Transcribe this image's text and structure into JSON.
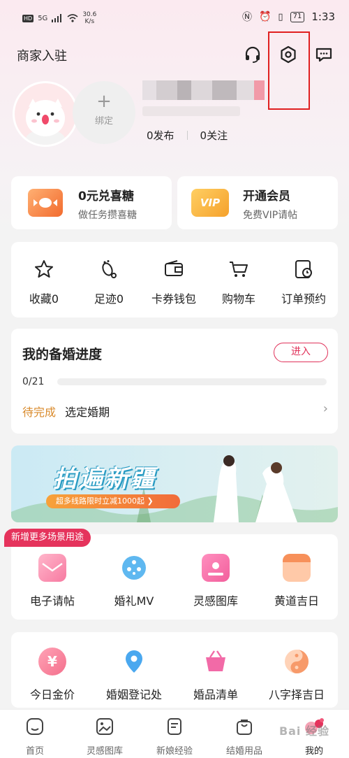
{
  "status_bar": {
    "hd": "HD",
    "signal": "5G",
    "speed": "30.6",
    "speed_unit": "K/s",
    "battery": "71",
    "time": "1:33"
  },
  "header": {
    "merchant_label": "商家入驻",
    "icons": [
      "headset-icon",
      "settings-icon",
      "message-icon"
    ]
  },
  "profile": {
    "bind_plus": "+",
    "bind_label": "绑定",
    "posts": "0发布",
    "follows": "0关注"
  },
  "promos": [
    {
      "title": "0元兑喜糖",
      "subtitle": "做任务攒喜糖",
      "icon": "candy-icon"
    },
    {
      "title": "开通会员",
      "subtitle": "免费VIP请帖",
      "icon": "vip-icon",
      "badge": "VIP"
    }
  ],
  "quick_actions": [
    {
      "label": "收藏0",
      "icon": "star-icon"
    },
    {
      "label": "足迹0",
      "icon": "footprint-icon"
    },
    {
      "label": "卡券钱包",
      "icon": "wallet-icon"
    },
    {
      "label": "购物车",
      "icon": "cart-icon"
    },
    {
      "label": "订单预约",
      "icon": "order-clock-icon"
    }
  ],
  "progress": {
    "title": "我的备婚进度",
    "enter": "进入",
    "count": "0/21",
    "ratio": 0,
    "todo_tag": "待完成",
    "todo_text": "选定婚期",
    "chevron": "›"
  },
  "banner": {
    "title": "拍遍新疆",
    "pill": "超多线路限时立减1000起 ❯"
  },
  "new_tag": "新增更多场景用途",
  "tools_row1": [
    {
      "label": "电子请帖",
      "icon": "invitation-icon",
      "color": "#f77aa1"
    },
    {
      "label": "婚礼MV",
      "icon": "film-reel-icon",
      "color": "#5fb8f0"
    },
    {
      "label": "灵感图库",
      "icon": "gallery-icon",
      "color": "#f25f9c"
    },
    {
      "label": "黄道吉日",
      "icon": "calendar-icon",
      "color": "#f7905a"
    }
  ],
  "tools_row2": [
    {
      "label": "今日金价",
      "icon": "gold-price-icon",
      "color": "#f46f8c"
    },
    {
      "label": "婚姻登记处",
      "icon": "location-pin-icon",
      "color": "#4aa8ef"
    },
    {
      "label": "婚品清单",
      "icon": "basket-icon",
      "color": "#f26aa7"
    },
    {
      "label": "八字择吉日",
      "icon": "yin-yang-icon",
      "color": "#f79a6a"
    }
  ],
  "tabbar": [
    {
      "label": "首页",
      "icon": "home-icon"
    },
    {
      "label": "灵感图库",
      "icon": "gallery-tab-icon"
    },
    {
      "label": "新娘经验",
      "icon": "notes-icon"
    },
    {
      "label": "结婚用品",
      "icon": "bag-icon"
    },
    {
      "label": "我的",
      "icon": "profile-icon",
      "active": true
    }
  ],
  "watermark": "Bai 经验"
}
